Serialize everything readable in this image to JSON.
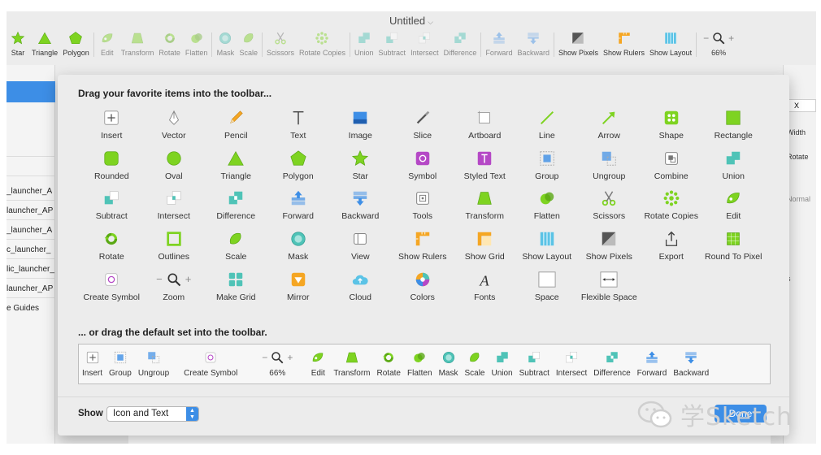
{
  "window": {
    "title": "Untitled"
  },
  "toolbar": {
    "items": [
      {
        "label": "Star",
        "icon": "star-icon",
        "dim": false
      },
      {
        "label": "Triangle",
        "icon": "triangle-icon",
        "dim": false
      },
      {
        "label": "Polygon",
        "icon": "polygon-icon",
        "dim": false
      },
      {
        "label": "Edit",
        "icon": "edit-icon",
        "dim": true
      },
      {
        "label": "Transform",
        "icon": "transform-icon",
        "dim": true
      },
      {
        "label": "Rotate",
        "icon": "rotate-icon",
        "dim": true
      },
      {
        "label": "Flatten",
        "icon": "flatten-icon",
        "dim": true
      },
      {
        "label": "Mask",
        "icon": "mask-icon",
        "dim": true
      },
      {
        "label": "Scale",
        "icon": "scale-icon",
        "dim": true
      },
      {
        "label": "Scissors",
        "icon": "scissors-icon",
        "dim": true
      },
      {
        "label": "Rotate Copies",
        "icon": "rotate-copies-icon",
        "dim": true
      },
      {
        "label": "Union",
        "icon": "union-icon",
        "dim": true
      },
      {
        "label": "Subtract",
        "icon": "subtract-icon",
        "dim": true
      },
      {
        "label": "Intersect",
        "icon": "intersect-icon",
        "dim": true
      },
      {
        "label": "Difference",
        "icon": "difference-icon",
        "dim": true
      },
      {
        "label": "Forward",
        "icon": "forward-icon",
        "dim": true
      },
      {
        "label": "Backward",
        "icon": "backward-icon",
        "dim": true
      },
      {
        "label": "Show Pixels",
        "icon": "show-pixels-icon",
        "dim": false
      },
      {
        "label": "Show Rulers",
        "icon": "show-rulers-icon",
        "dim": false
      },
      {
        "label": "Show Layout",
        "icon": "show-layout-icon",
        "dim": false
      },
      {
        "label": "66%",
        "icon": "zoom-icon",
        "dim": false
      }
    ]
  },
  "left_panel": {
    "rows": [
      "_launcher_A",
      "launcher_AP",
      "_launcher_A",
      "c_launcher_",
      "lic_launcher_",
      "launcher_AP",
      "e Guides"
    ]
  },
  "right_panel": {
    "x_label": "X",
    "width_label": "Width",
    "rotate_label": "Rotate",
    "normal_label": "Normal",
    "s_label": "s"
  },
  "sheet": {
    "heading_favorites": "Drag your favorite items into the toolbar...",
    "heading_default": "... or drag the default set into the toolbar.",
    "items": [
      {
        "label": "Insert",
        "icon": "insert-icon"
      },
      {
        "label": "Vector",
        "icon": "vector-icon"
      },
      {
        "label": "Pencil",
        "icon": "pencil-icon"
      },
      {
        "label": "Text",
        "icon": "text-icon"
      },
      {
        "label": "Image",
        "icon": "image-icon"
      },
      {
        "label": "Slice",
        "icon": "slice-icon"
      },
      {
        "label": "Artboard",
        "icon": "artboard-icon"
      },
      {
        "label": "Line",
        "icon": "line-icon"
      },
      {
        "label": "Arrow",
        "icon": "arrow-icon"
      },
      {
        "label": "Shape",
        "icon": "shape-icon"
      },
      {
        "label": "Rectangle",
        "icon": "rectangle-icon"
      },
      {
        "label": "Rounded",
        "icon": "rounded-icon"
      },
      {
        "label": "Oval",
        "icon": "oval-icon"
      },
      {
        "label": "Triangle",
        "icon": "triangle-icon"
      },
      {
        "label": "Polygon",
        "icon": "polygon-icon"
      },
      {
        "label": "Star",
        "icon": "star-icon"
      },
      {
        "label": "Symbol",
        "icon": "symbol-icon"
      },
      {
        "label": "Styled Text",
        "icon": "styled-text-icon"
      },
      {
        "label": "Group",
        "icon": "group-icon"
      },
      {
        "label": "Ungroup",
        "icon": "ungroup-icon"
      },
      {
        "label": "Combine",
        "icon": "combine-icon"
      },
      {
        "label": "Union",
        "icon": "union-icon"
      },
      {
        "label": "Subtract",
        "icon": "subtract-icon"
      },
      {
        "label": "Intersect",
        "icon": "intersect-icon"
      },
      {
        "label": "Difference",
        "icon": "difference-icon"
      },
      {
        "label": "Forward",
        "icon": "forward-icon"
      },
      {
        "label": "Backward",
        "icon": "backward-icon"
      },
      {
        "label": "Tools",
        "icon": "tools-icon"
      },
      {
        "label": "Transform",
        "icon": "transform-icon"
      },
      {
        "label": "Flatten",
        "icon": "flatten-icon"
      },
      {
        "label": "Scissors",
        "icon": "scissors-icon"
      },
      {
        "label": "Rotate Copies",
        "icon": "rotate-copies-icon"
      },
      {
        "label": "Edit",
        "icon": "edit-icon"
      },
      {
        "label": "Rotate",
        "icon": "rotate-icon"
      },
      {
        "label": "Outlines",
        "icon": "outlines-icon"
      },
      {
        "label": "Scale",
        "icon": "scale-icon"
      },
      {
        "label": "Mask",
        "icon": "mask-icon"
      },
      {
        "label": "View",
        "icon": "view-icon"
      },
      {
        "label": "Show Rulers",
        "icon": "show-rulers-icon"
      },
      {
        "label": "Show Grid",
        "icon": "show-grid-icon"
      },
      {
        "label": "Show Layout",
        "icon": "show-layout-icon"
      },
      {
        "label": "Show Pixels",
        "icon": "show-pixels-icon"
      },
      {
        "label": "Export",
        "icon": "export-icon"
      },
      {
        "label": "Round To Pixel",
        "icon": "round-to-pixel-icon"
      },
      {
        "label": "Create Symbol",
        "icon": "create-symbol-icon"
      },
      {
        "label": "Zoom",
        "icon": "zoom-icon"
      },
      {
        "label": "Make Grid",
        "icon": "make-grid-icon"
      },
      {
        "label": "Mirror",
        "icon": "mirror-icon"
      },
      {
        "label": "Cloud",
        "icon": "cloud-icon"
      },
      {
        "label": "Colors",
        "icon": "colors-icon"
      },
      {
        "label": "Fonts",
        "icon": "fonts-icon"
      },
      {
        "label": "Space",
        "icon": "space-icon"
      },
      {
        "label": "Flexible Space",
        "icon": "flexible-space-icon"
      }
    ],
    "default_set": [
      {
        "label": "Insert",
        "icon": "insert-icon"
      },
      {
        "label": "Group",
        "icon": "group-icon"
      },
      {
        "label": "Ungroup",
        "icon": "ungroup-icon"
      },
      {
        "label": "Create Symbol",
        "icon": "create-symbol-icon"
      },
      {
        "label": "66%",
        "icon": "zoom-icon"
      },
      {
        "label": "Edit",
        "icon": "edit-icon"
      },
      {
        "label": "Transform",
        "icon": "transform-icon"
      },
      {
        "label": "Rotate",
        "icon": "rotate-icon"
      },
      {
        "label": "Flatten",
        "icon": "flatten-icon"
      },
      {
        "label": "Mask",
        "icon": "mask-icon"
      },
      {
        "label": "Scale",
        "icon": "scale-icon"
      },
      {
        "label": "Union",
        "icon": "union-icon"
      },
      {
        "label": "Subtract",
        "icon": "subtract-icon"
      },
      {
        "label": "Intersect",
        "icon": "intersect-icon"
      },
      {
        "label": "Difference",
        "icon": "difference-icon"
      },
      {
        "label": "Forward",
        "icon": "forward-icon"
      },
      {
        "label": "Backward",
        "icon": "backward-icon"
      }
    ],
    "show_label": "Show",
    "show_value": "Icon and Text",
    "done_label": "Done"
  },
  "watermark": {
    "text": "学Sketch"
  },
  "colors": {
    "accent": "#3d8ee6",
    "green": "#7ed321",
    "teal": "#4fc3b7",
    "orange": "#f5a623",
    "purple": "#b548c6"
  }
}
